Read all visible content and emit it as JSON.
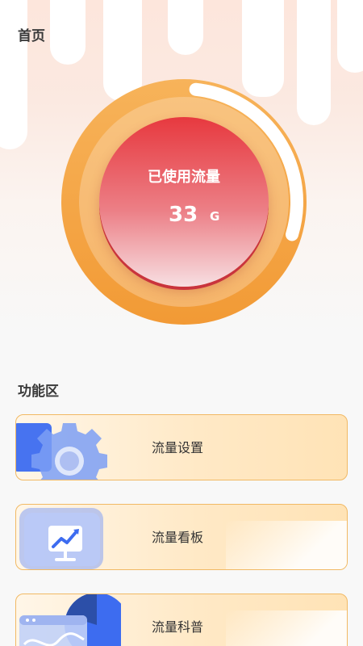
{
  "header": {
    "title": "首页"
  },
  "usage": {
    "label": "已使用流量",
    "value": "33",
    "unit": "G",
    "fraction": 0.28
  },
  "functions": {
    "title": "功能区",
    "items": [
      {
        "label": "流量设置",
        "icon": "gear-icon"
      },
      {
        "label": "流量看板",
        "icon": "chart-board-icon"
      },
      {
        "label": "流量科普",
        "icon": "pie-chart-icon"
      }
    ]
  },
  "colors": {
    "ring": "#f4a13a",
    "inner_top": "#e7393f",
    "card_border": "#f1b964",
    "icon_blue": "#3d6cf0"
  }
}
